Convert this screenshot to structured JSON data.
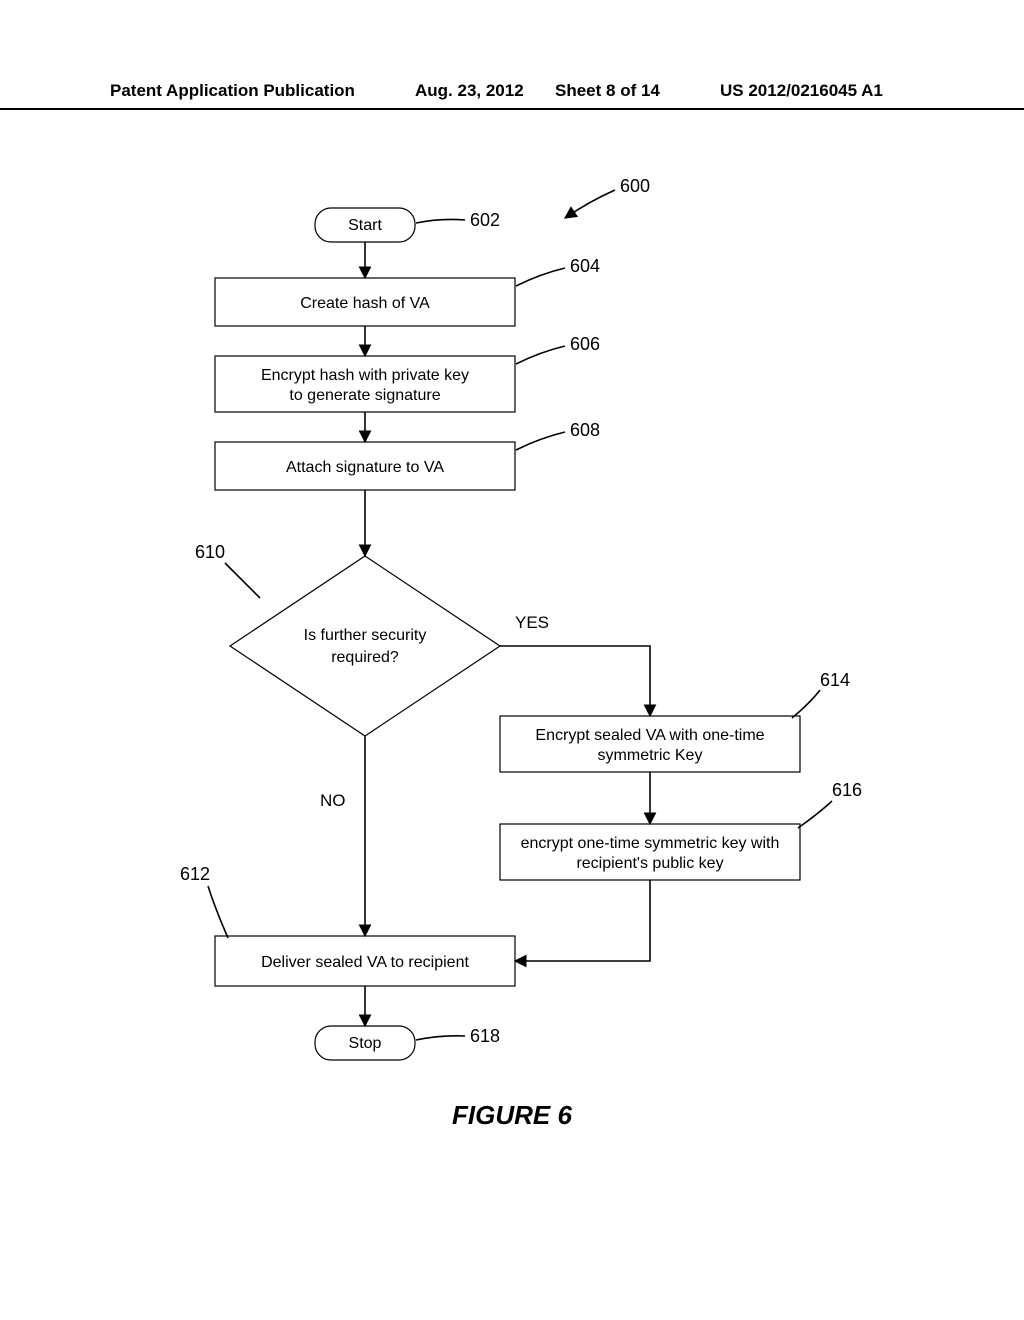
{
  "header": {
    "left": "Patent Application Publication",
    "date": "Aug. 23, 2012",
    "sheet": "Sheet 8 of 14",
    "pubno": "US 2012/0216045 A1"
  },
  "chart_data": {
    "type": "flowchart",
    "title": "FIGURE 6",
    "nodes": [
      {
        "id": "600",
        "kind": "label",
        "text": "600"
      },
      {
        "id": "602",
        "kind": "terminator",
        "text": "Start"
      },
      {
        "id": "604",
        "kind": "process",
        "text": "Create hash of VA"
      },
      {
        "id": "606",
        "kind": "process",
        "text": "Encrypt hash with private key to generate signature"
      },
      {
        "id": "608",
        "kind": "process",
        "text": "Attach signature to VA"
      },
      {
        "id": "610",
        "kind": "decision",
        "text": "Is further security required?"
      },
      {
        "id": "614",
        "kind": "process",
        "text": "Encrypt sealed VA  with one-time symmetric Key"
      },
      {
        "id": "616",
        "kind": "process",
        "text": "encrypt one-time symmetric key with recipient's public key"
      },
      {
        "id": "612",
        "kind": "process",
        "text": "Deliver sealed VA to recipient"
      },
      {
        "id": "618",
        "kind": "terminator",
        "text": "Stop"
      }
    ],
    "edges": [
      {
        "from": "602",
        "to": "604"
      },
      {
        "from": "604",
        "to": "606"
      },
      {
        "from": "606",
        "to": "608"
      },
      {
        "from": "608",
        "to": "610"
      },
      {
        "from": "610",
        "to": "614",
        "label": "YES"
      },
      {
        "from": "610",
        "to": "612",
        "label": "NO"
      },
      {
        "from": "614",
        "to": "616"
      },
      {
        "from": "616",
        "to": "612"
      },
      {
        "from": "612",
        "to": "618"
      }
    ]
  },
  "labels": {
    "l600": "600",
    "l602": "602",
    "l604": "604",
    "l606": "606",
    "l608": "608",
    "l610": "610",
    "l612": "612",
    "l614": "614",
    "l616": "616",
    "l618": "618",
    "yes": "YES",
    "no": "NO"
  },
  "nodes": {
    "start": "Start",
    "stop": "Stop",
    "n604": "Create hash of VA",
    "n606a": "Encrypt hash with private key",
    "n606b": "to generate signature",
    "n608": "Attach signature to VA",
    "n610a": "Is further security",
    "n610b": "required?",
    "n614a": "Encrypt sealed VA  with one-time",
    "n614b": "symmetric Key",
    "n616a": "encrypt one-time symmetric key with",
    "n616b": "recipient's public key",
    "n612": "Deliver sealed VA to recipient"
  },
  "caption": "FIGURE 6"
}
